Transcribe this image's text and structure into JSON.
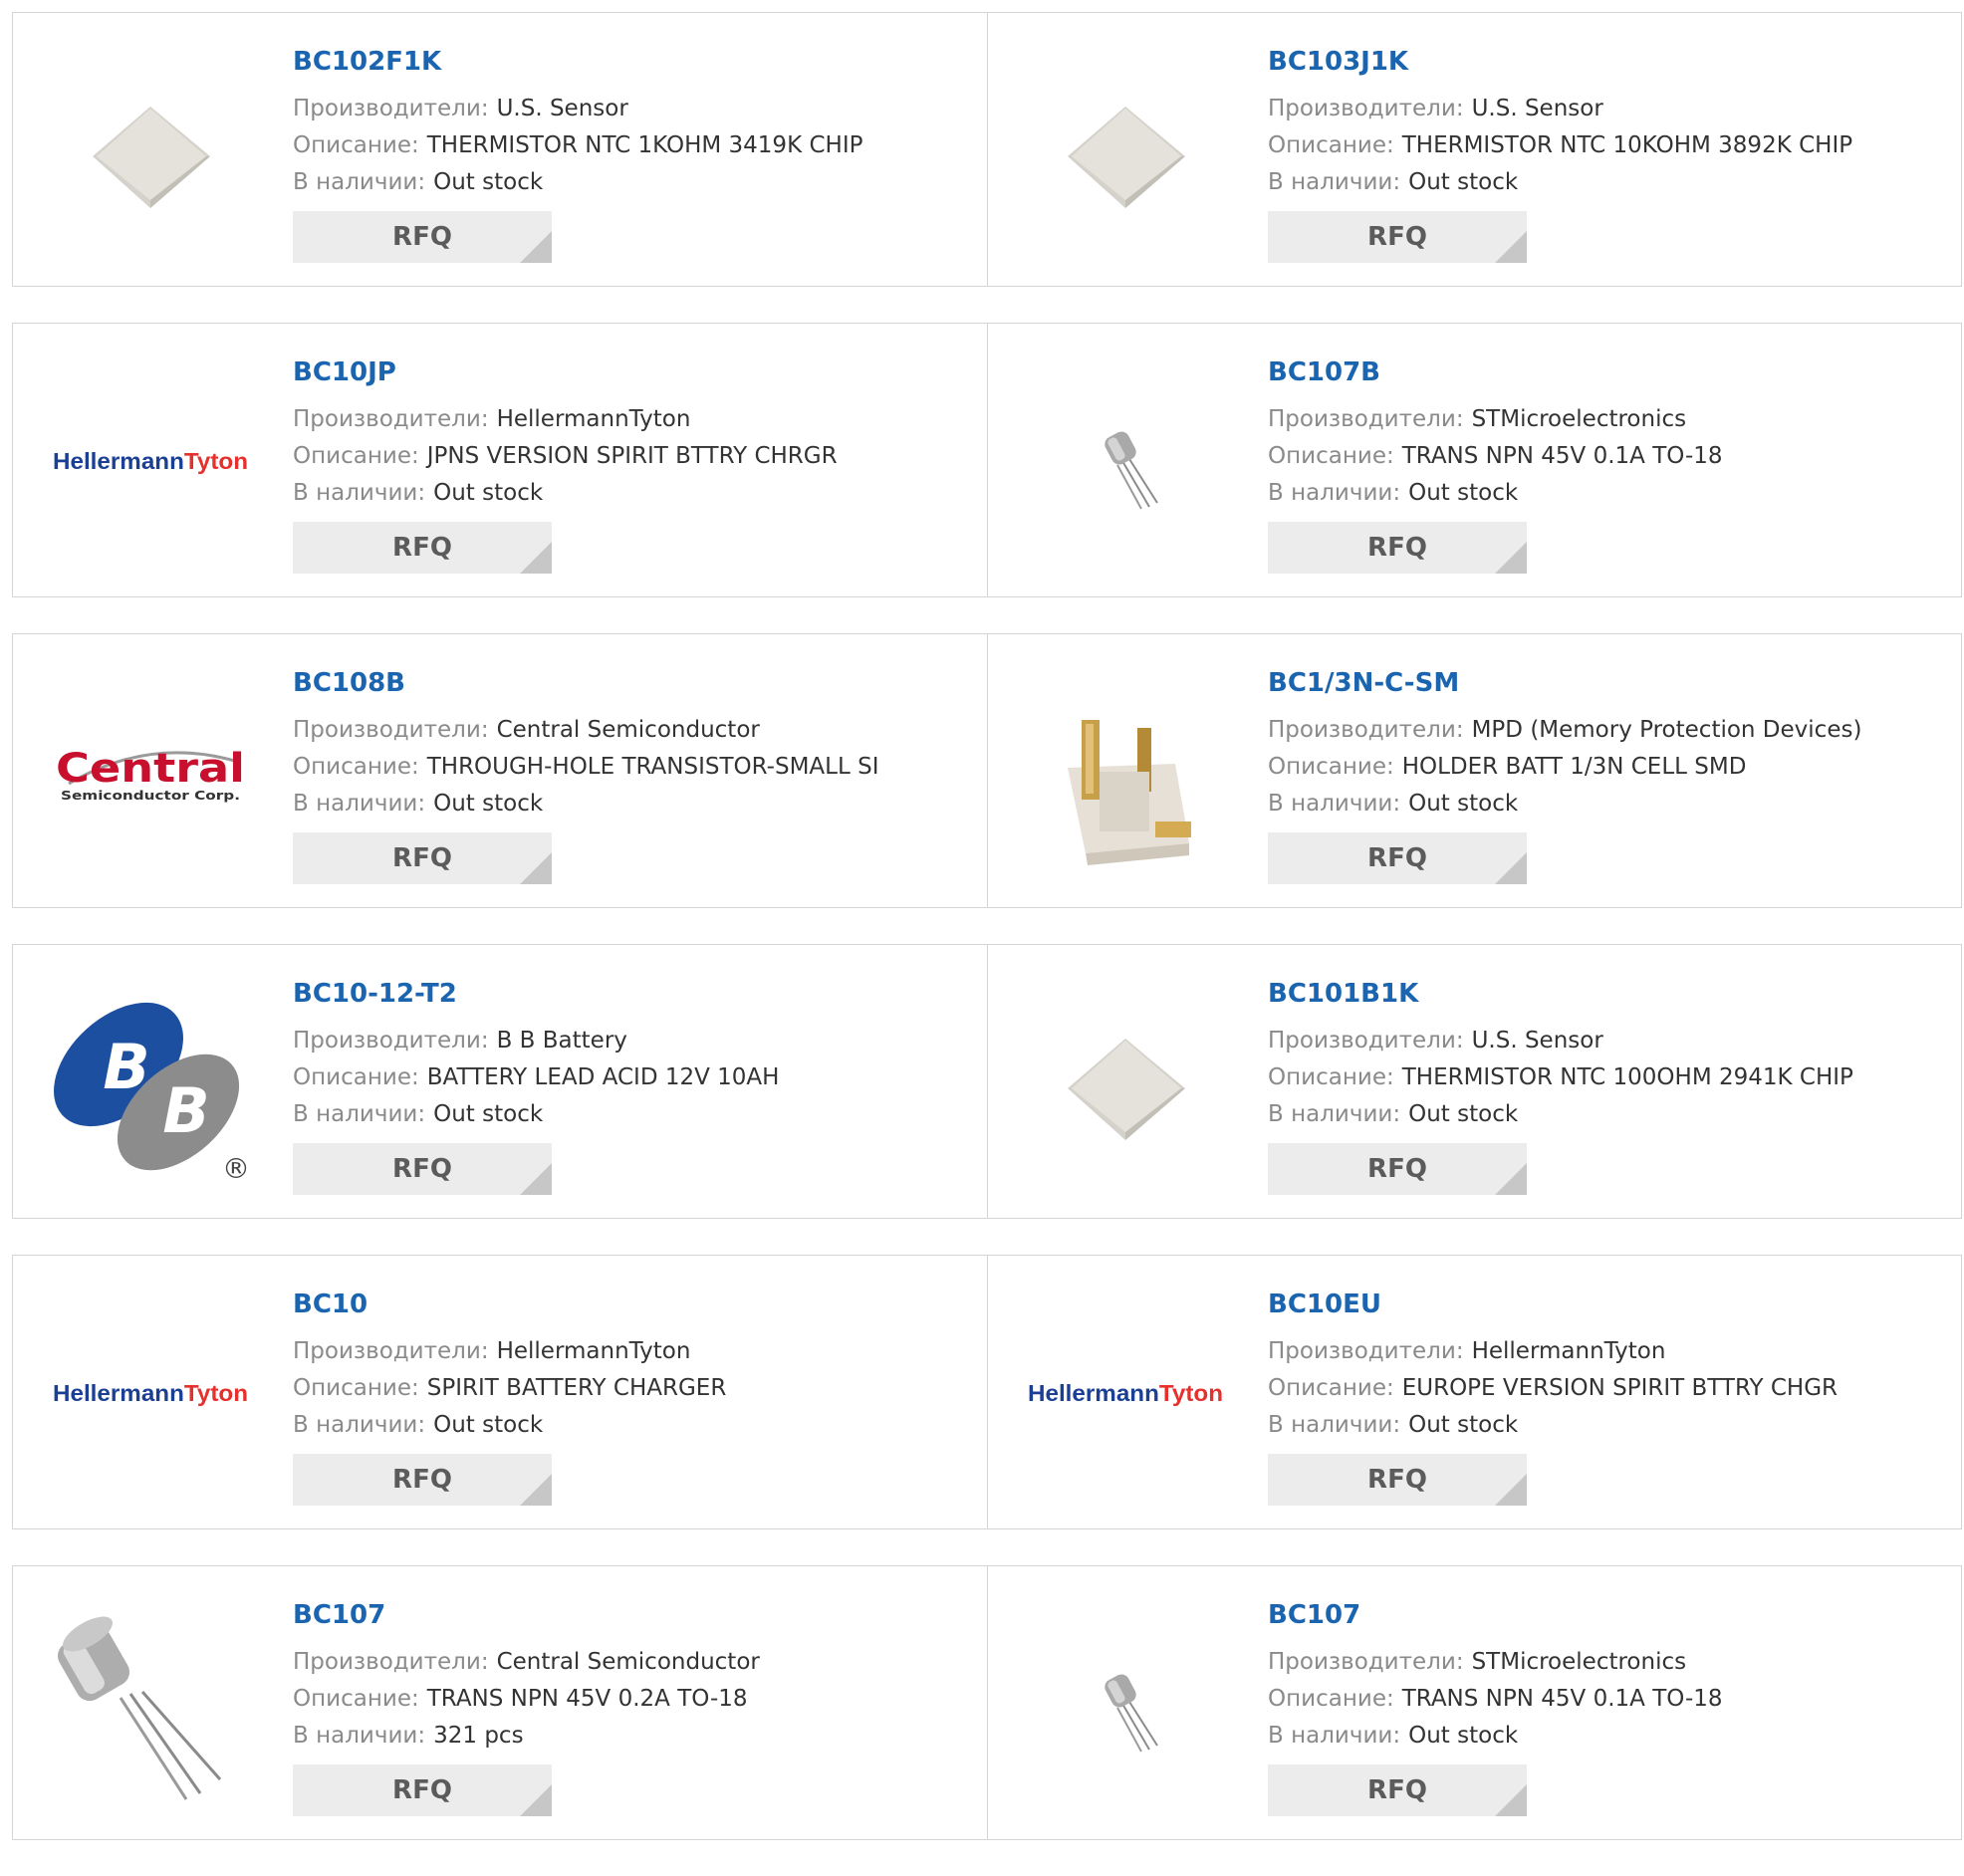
{
  "labels": {
    "manufacturer": "Производители:",
    "description": "Описание:",
    "stock": "В наличии:",
    "rfq": "RFQ"
  },
  "products": [
    {
      "part": "BC102F1K",
      "manufacturer": "U.S. Sensor",
      "description": "THERMISTOR NTC 1KOHM 3419K CHIP",
      "stock": "Out stock",
      "image": "thermistor-chip"
    },
    {
      "part": "BC103J1K",
      "manufacturer": "U.S. Sensor",
      "description": "THERMISTOR NTC 10KOHM 3892K CHIP",
      "stock": "Out stock",
      "image": "thermistor-chip"
    },
    {
      "part": "BC10JP",
      "manufacturer": "HellermannTyton",
      "description": "JPNS VERSION SPIRIT BTTRY CHRGR",
      "stock": "Out stock",
      "image": "hellermanntyton-logo"
    },
    {
      "part": "BC107B",
      "manufacturer": "STMicroelectronics",
      "description": "TRANS NPN 45V 0.1A TO-18",
      "stock": "Out stock",
      "image": "transistor-small"
    },
    {
      "part": "BC108B",
      "manufacturer": "Central Semiconductor",
      "description": "THROUGH-HOLE TRANSISTOR-SMALL SI",
      "stock": "Out stock",
      "image": "central-logo"
    },
    {
      "part": "BC1/3N-C-SM",
      "manufacturer": "MPD (Memory Protection Devices)",
      "description": "HOLDER BATT 1/3N CELL SMD",
      "stock": "Out stock",
      "image": "battery-holder"
    },
    {
      "part": "BC10-12-T2",
      "manufacturer": "B B Battery",
      "description": "BATTERY LEAD ACID 12V 10AH",
      "stock": "Out stock",
      "image": "bb-battery-logo"
    },
    {
      "part": "BC101B1K",
      "manufacturer": "U.S. Sensor",
      "description": "THERMISTOR NTC 100OHM 2941K CHIP",
      "stock": "Out stock",
      "image": "thermistor-chip"
    },
    {
      "part": "BC10",
      "manufacturer": "HellermannTyton",
      "description": "SPIRIT BATTERY CHARGER",
      "stock": "Out stock",
      "image": "hellermanntyton-logo"
    },
    {
      "part": "BC10EU",
      "manufacturer": "HellermannTyton",
      "description": "EUROPE VERSION SPIRIT BTTRY CHGR",
      "stock": "Out stock",
      "image": "hellermanntyton-logo"
    },
    {
      "part": "BC107",
      "manufacturer": "Central Semiconductor",
      "description": "TRANS NPN 45V 0.2A TO-18",
      "stock": "321 pcs",
      "image": "transistor-large"
    },
    {
      "part": "BC107",
      "manufacturer": "STMicroelectronics",
      "description": "TRANS NPN 45V 0.1A TO-18",
      "stock": "Out stock",
      "image": "transistor-small"
    }
  ],
  "logos": {
    "hellermann": "Hellermann",
    "tyton": "Tyton",
    "central": "Central",
    "central_sub": "Semiconductor Corp.",
    "bb": "B",
    "registered": "®"
  },
  "colors": {
    "link": "#1a64b0",
    "label": "#8a8a8a",
    "value": "#333333",
    "border": "#d4d4d4",
    "rfq_bg": "#ececec",
    "rfq_text": "#5b5b5b",
    "hellermann_blue": "#1b3f94",
    "tyton_red": "#e5302d",
    "central_red": "#c8102e",
    "bb_blue": "#1d4fa0",
    "bb_gray": "#8c8c8c"
  }
}
